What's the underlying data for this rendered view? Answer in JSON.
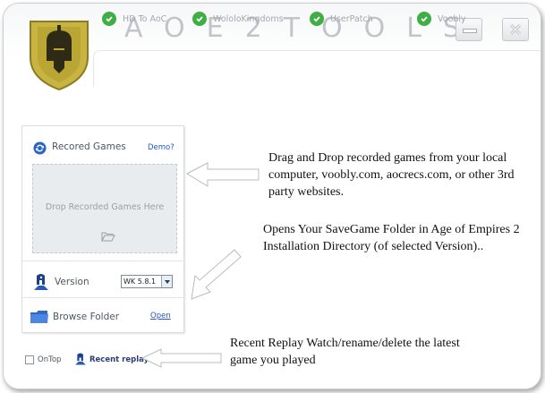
{
  "window": {
    "title": "AOE2TOOLS",
    "minimize_icon": "minimize-icon",
    "close_icon": "close-icon"
  },
  "tabs": [
    {
      "label": "HD To AoC",
      "icon": "check-circle-icon"
    },
    {
      "label": "WololoKingdoms",
      "icon": "check-circle-icon"
    },
    {
      "label": "UserPatch",
      "icon": "check-circle-icon"
    },
    {
      "label": "Voobly",
      "icon": "check-circle-icon"
    }
  ],
  "recorded_games": {
    "title": "Recored Games",
    "demo_link": "Demo?",
    "drop_text": "Drop Recorded Games Here",
    "icon": "refresh-icon"
  },
  "version": {
    "label": "Version",
    "selected": "WK 5.8.1",
    "icon": "spartan-icon"
  },
  "browse": {
    "label": "Browse Folder",
    "open_link": "Open",
    "icon": "folder-icon"
  },
  "footer": {
    "ontop_label": "OnTop",
    "recent_replay_label": "Recent replay"
  },
  "callouts": {
    "drag_drop": "Drag and Drop recorded games from your local computer, voobly.com, aocrecs.com, or other 3rd party websites.",
    "savegame": "Opens Your SaveGame Folder in Age of Empires 2 Installation Directory (of selected Version)..",
    "recent": "Recent Replay Watch/rename/delete the latest game you played"
  },
  "colors": {
    "check_green": "#3fae44",
    "link_blue": "#2457c8",
    "logo_gold": "#c9b441"
  }
}
